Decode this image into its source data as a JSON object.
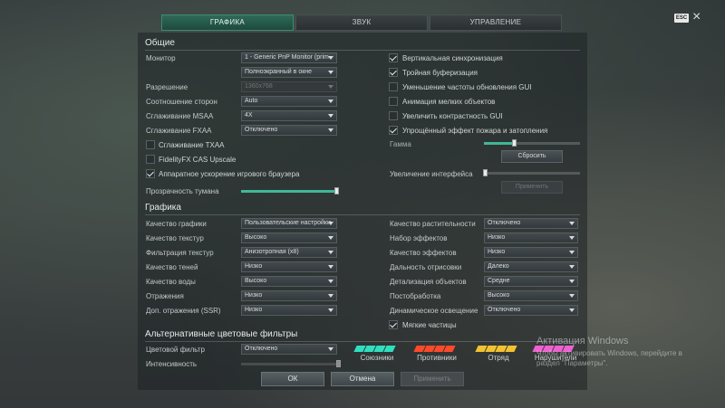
{
  "tabs": [
    {
      "label": "ГРАФИКА",
      "active": true
    },
    {
      "label": "ЗВУК",
      "active": false
    },
    {
      "label": "УПРАВЛЕНИЕ",
      "active": false
    }
  ],
  "esc_label": "ESC",
  "close_symbol": "×",
  "general": {
    "title": "Общие",
    "monitor_label": "Монитор",
    "monitor_value": "1 - Generic PnP Monitor (prim",
    "screen_mode_value": "Полноэкранный в окне",
    "resolution_label": "Разрешение",
    "resolution_value": "1360x768",
    "aspect_label": "Соотношение сторон",
    "aspect_value": "Auto",
    "msaa_label": "Сглаживание MSAA",
    "msaa_value": "4X",
    "fxaa_label": "Сглаживание FXAA",
    "fxaa_value": "Отключено",
    "txaa_label": "Сглаживание TXAA",
    "txaa_checked": false,
    "fidelity_label": "FidelityFX CAS Upscale",
    "fidelity_checked": false,
    "browser_accel_label": "Аппаратное ускорение игрового браузера",
    "browser_accel_checked": true,
    "fog_label": "Прозрачность тумана",
    "fog_value": 0.98,
    "vsync_label": "Вертикальная синхронизация",
    "vsync_checked": true,
    "triple_label": "Тройная буферизация",
    "triple_checked": true,
    "gui_rate_label": "Уменьшение частоты обновления GUI",
    "gui_rate_checked": false,
    "small_anim_label": "Анимация мелких объектов",
    "small_anim_checked": false,
    "gui_contrast_label": "Увеличить контрастность GUI",
    "gui_contrast_checked": false,
    "fire_label": "Упрощённый эффект пожара и затопления",
    "fire_checked": true,
    "gamma_label": "Гамма",
    "gamma_value": 0.32,
    "reset_label": "Сбросить",
    "ui_scale_label": "Увеличение интерфейса",
    "ui_scale_value": 0.0,
    "apply_scale_label": "Применить"
  },
  "graphics": {
    "title": "Графика",
    "left": [
      {
        "label": "Качество графики",
        "value": "Пользовательские настройки"
      },
      {
        "label": "Качество текстур",
        "value": "Высоко"
      },
      {
        "label": "Фильтрация текстур",
        "value": "Анизотропная (x8)"
      },
      {
        "label": "Качество теней",
        "value": "Низко"
      },
      {
        "label": "Качество воды",
        "value": "Высоко"
      },
      {
        "label": "Отражения",
        "value": "Низко"
      },
      {
        "label": "Доп. отражения (SSR)",
        "value": "Низко"
      }
    ],
    "right": [
      {
        "label": "Качество растительности",
        "value": "Отключено"
      },
      {
        "label": "Набор эффектов",
        "value": "Низко"
      },
      {
        "label": "Качество эффектов",
        "value": "Низко"
      },
      {
        "label": "Дальность отрисовки",
        "value": "Далеко"
      },
      {
        "label": "Детализация объектов",
        "value": "Средне"
      },
      {
        "label": "Постобработка",
        "value": "Высоко"
      },
      {
        "label": "Динамическое освещение",
        "value": "Отключено"
      }
    ],
    "soft_particles_label": "Мягкие частицы",
    "soft_particles_checked": true
  },
  "color_filters": {
    "title": "Альтернативные цветовые фильтры",
    "filter_label": "Цветовой фильтр",
    "filter_value": "Отключено",
    "intensity_label": "Интенсивность",
    "intensity_value": 1.0,
    "groups": [
      {
        "label": "Союзники",
        "colors": [
          "#2fe0c0",
          "#2fe0c0",
          "#2fe0c0",
          "#2fe0c0"
        ]
      },
      {
        "label": "Противники",
        "colors": [
          "#ff4a2a",
          "#ff4a2a",
          "#ff4a2a",
          "#ff4a2a"
        ]
      },
      {
        "label": "Отряд",
        "colors": [
          "#f2c230",
          "#f2c230",
          "#f2c230",
          "#f2c230"
        ]
      },
      {
        "label": "Нарушители",
        "colors": [
          "#f060d0",
          "#f060d0",
          "#f060d0",
          "#f060d0"
        ]
      }
    ]
  },
  "buttons": {
    "ok": "ОК",
    "cancel": "Отмена",
    "apply": "Применить"
  },
  "watermark": {
    "line1": "Активация Windows",
    "line2": "Чтобы активировать Windows, перейдите в",
    "line3": "раздел \"Параметры\"."
  },
  "colors": {
    "accent": "#3fb898",
    "tab_active": "#2f6a58"
  }
}
